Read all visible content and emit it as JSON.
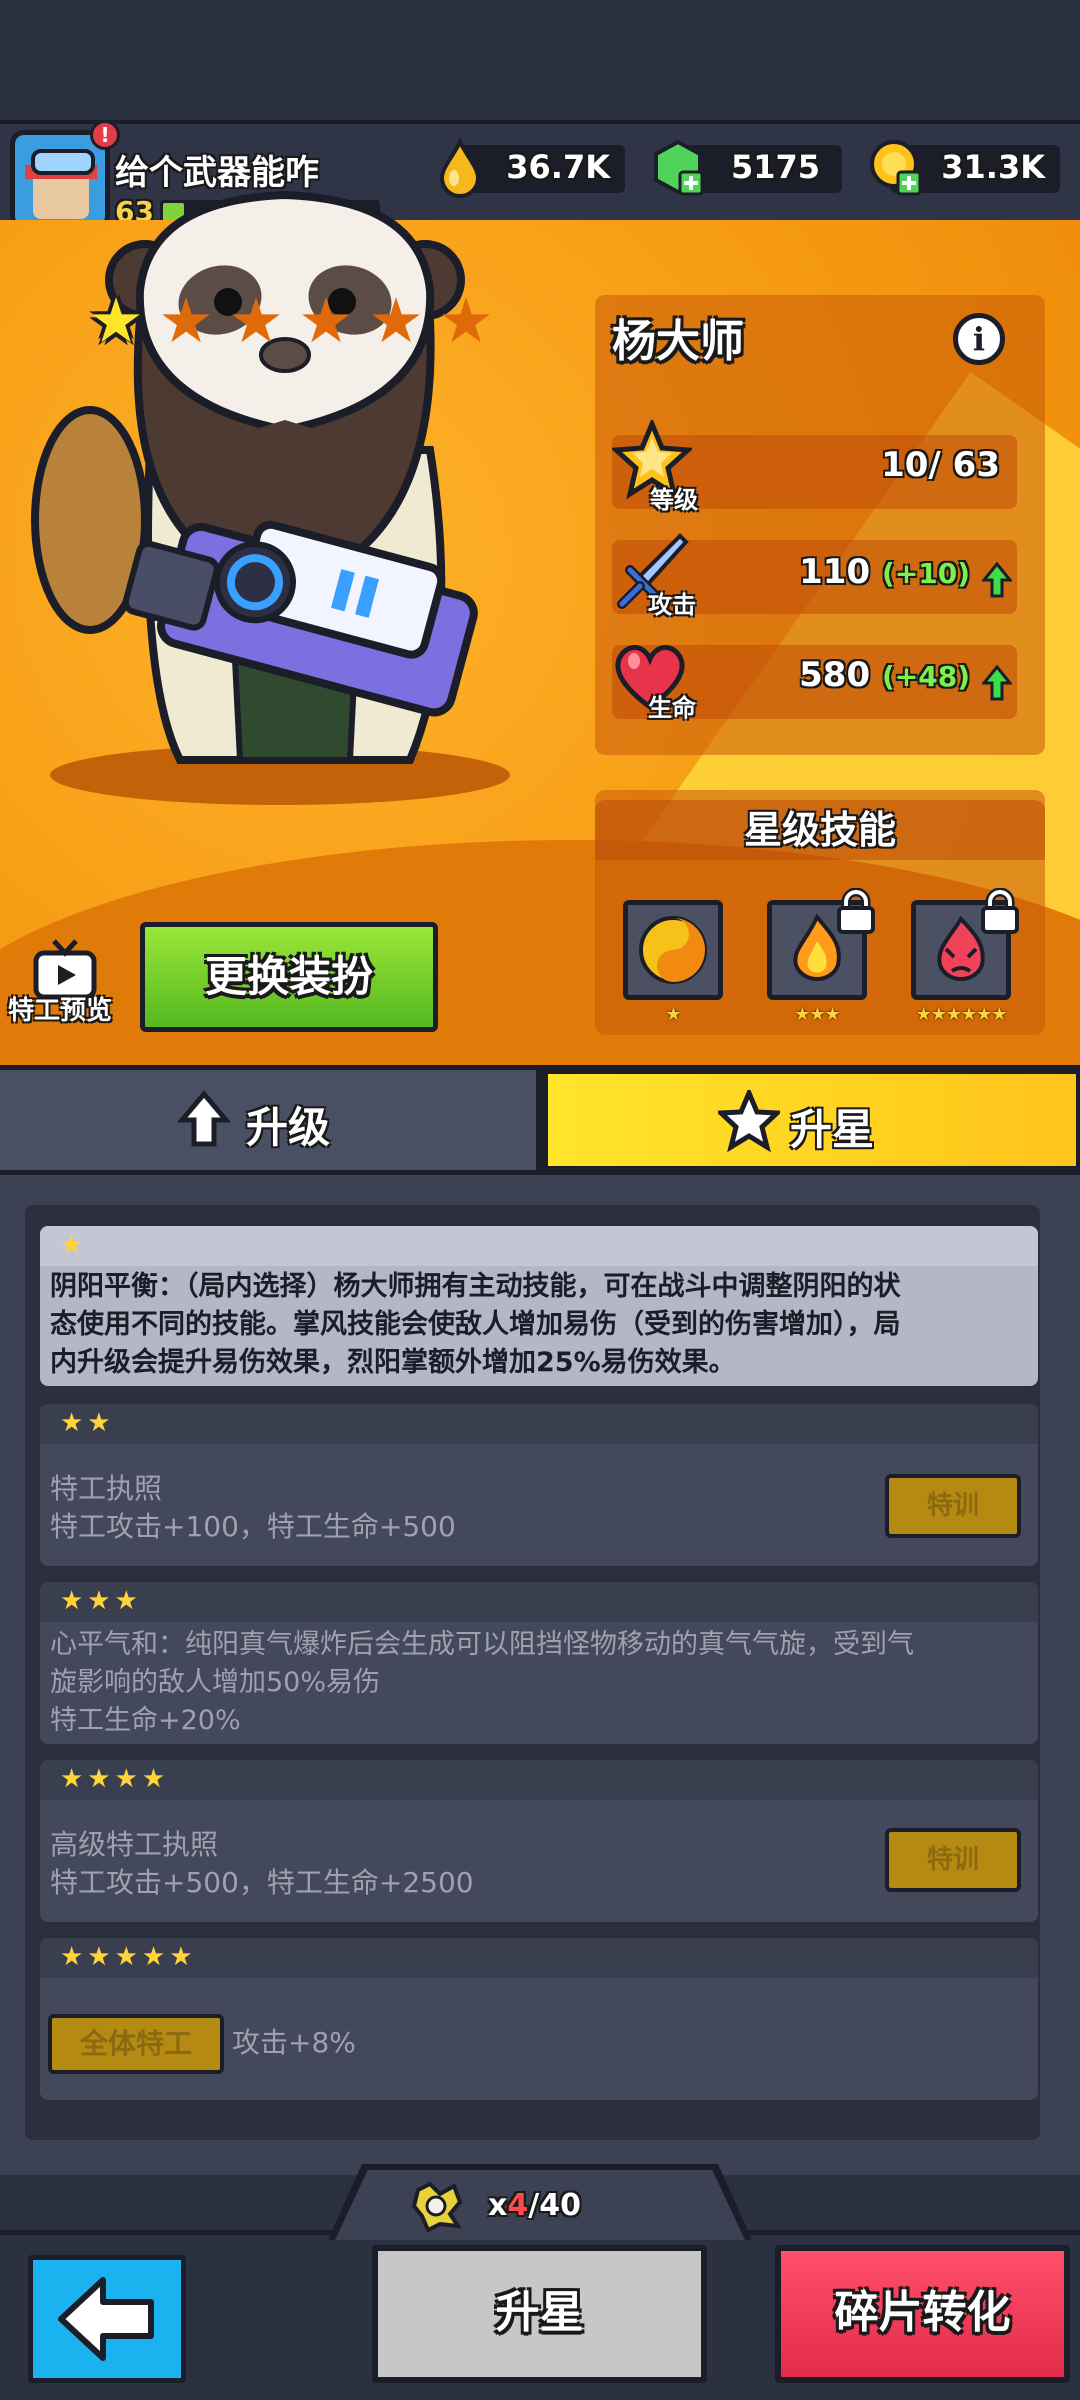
{
  "player": {
    "name": "给个武器能咋",
    "level": "63",
    "alert": "!",
    "xp_fraction": 0.1
  },
  "resources": {
    "elixir": "36.7K",
    "gems": "5175",
    "coins": "31.3K"
  },
  "hero": {
    "name": "杨大师",
    "star_level": 1,
    "max_stars": 6,
    "info_icon": "i",
    "stats": {
      "level_label": "等级",
      "level_value": "10/ 63",
      "attack_label": "攻击",
      "attack_value": "110",
      "attack_bonus": "(+10)",
      "hp_label": "生命",
      "hp_value": "580",
      "hp_bonus": "(+48)"
    },
    "skills_title": "星级技能",
    "skills": [
      {
        "icon": "yin-yang-icon",
        "stars": "★",
        "locked": false
      },
      {
        "icon": "fire-icon",
        "stars": "★★★",
        "locked": true
      },
      {
        "icon": "demon-fire-icon",
        "stars": "★★★★★★",
        "locked": true
      }
    ],
    "preview_label": "特工预览",
    "change_outfit": "更换装扮"
  },
  "tabs": {
    "upgrade": "升级",
    "star_up": "升星"
  },
  "star_sections": [
    {
      "stars": "★",
      "lines": [
        "阴阳平衡：（局内选择）杨大师拥有主动技能，可在战斗中调整阴阳的状",
        "态使用不同的技能。掌风技能会使敌人增加易伤（受到的伤害增加），局",
        "内升级会提升易伤效果，烈阳掌额外增加25%易伤效果。"
      ],
      "active": true
    },
    {
      "stars": "★★",
      "lines": [
        "特工执照",
        "特工攻击+100，特工生命+500"
      ],
      "button": "特训"
    },
    {
      "stars": "★★★",
      "lines": [
        "心平气和：纯阳真气爆炸后会生成可以阻挡怪物移动的真气气旋，受到气",
        "旋影响的敌人增加50%易伤",
        "特工生命+20%"
      ]
    },
    {
      "stars": "★★★★",
      "lines": [
        "高级特工执照",
        "特工攻击+500，特工生命+2500"
      ],
      "button": "特训"
    },
    {
      "stars": "★★★★★",
      "tag": "全体特工",
      "lines": [
        "攻击+8%"
      ]
    }
  ],
  "bottom": {
    "shard_prefix": "x",
    "shard_have": "4",
    "shard_need": "/40",
    "star_up_button": "升星",
    "convert_button": "碎片转化"
  },
  "colors": {
    "accent_orange": "#f59a12",
    "green": "#7fd43a",
    "yellow": "#ffd43a",
    "red_button": "#e22b4a",
    "blue_button": "#1ab3f0"
  }
}
